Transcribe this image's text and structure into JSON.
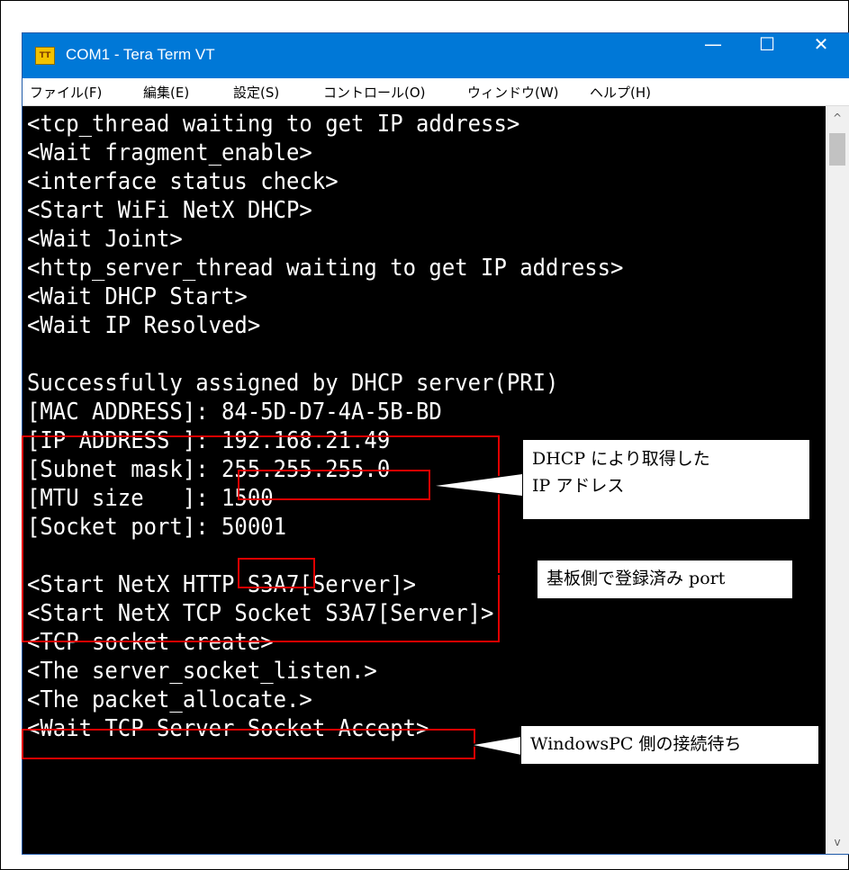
{
  "window": {
    "title": "COM1 - Tera Term VT",
    "icon_label": "TT",
    "minimize_glyph": "—",
    "maximize_glyph": "☐",
    "close_glyph": "✕"
  },
  "menu": {
    "items": [
      "ファイル(F)",
      "編集(E)",
      "設定(S)",
      "コントロール(O)",
      "ウィンドウ(W)",
      "ヘルプ(H)"
    ]
  },
  "terminal": {
    "lines": [
      "<tcp_thread waiting to get IP address>",
      "<Wait fragment_enable>",
      "<interface status check>",
      "<Start WiFi NetX DHCP>",
      "<Wait Joint>",
      "<http_server_thread waiting to get IP address>",
      "<Wait DHCP Start>",
      "<Wait IP Resolved>",
      "",
      "Successfully assigned by DHCP server(PRI)",
      "[MAC ADDRESS]: 84-5D-D7-4A-5B-BD",
      "[IP ADDRESS ]: 192.168.21.49",
      "[Subnet mask]: 255.255.255.0",
      "[MTU size   ]: 1500",
      "[Socket port]: 50001",
      "",
      "<Start NetX HTTP S3A7[Server]>",
      "<Start NetX TCP Socket S3A7[Server]>",
      "<TCP socket create>",
      "<The server_socket_listen.>",
      "<The packet_allocate.>",
      "<Wait TCP Server Socket Accept>"
    ]
  },
  "scrollbar": {
    "up_glyph": "^",
    "down_glyph": "v"
  },
  "annotations": {
    "dhcp_ip_line1": "DHCP により取得した",
    "dhcp_ip_line2": "IP アドレス",
    "registered_port": "基板側で登録済み port",
    "waiting_connection": "WindowsPC 側の接続待ち",
    "highlight_color": "#e00000"
  }
}
